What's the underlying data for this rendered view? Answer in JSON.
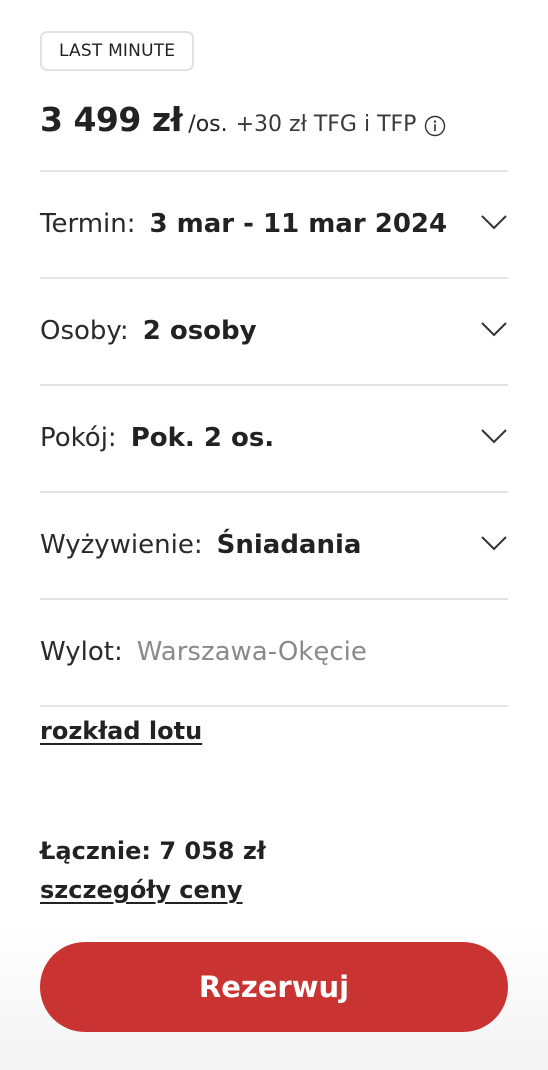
{
  "badge": {
    "label": "LAST MINUTE"
  },
  "price": {
    "amount": "3 499 zł",
    "per_person": "/os.",
    "extra": "+30 zł TFG i TFP"
  },
  "rows": [
    {
      "label": "Termin:",
      "value": "3 mar - 11 mar 2024",
      "has_chevron": true
    },
    {
      "label": "Osoby:",
      "value": "2 osoby",
      "has_chevron": true
    },
    {
      "label": "Pokój:",
      "value": "Pok. 2 os.",
      "has_chevron": true
    },
    {
      "label": "Wyżywienie:",
      "value": "Śniadania",
      "has_chevron": true
    },
    {
      "label": "Wylot:",
      "value": "Warszawa-Okęcie",
      "has_chevron": false
    }
  ],
  "links": {
    "flight_schedule": "rozkład lotu",
    "price_details": "szczegóły ceny"
  },
  "total": {
    "label": "Łącznie: 7 058 zł"
  },
  "cta": {
    "label": "Rezerwuj"
  },
  "colors": {
    "accent": "#c93432",
    "divider": "#e4e4e4",
    "muted_text": "#8a8a8a"
  },
  "icons": {
    "info": "info-circle-icon",
    "chevron": "chevron-down-icon"
  }
}
